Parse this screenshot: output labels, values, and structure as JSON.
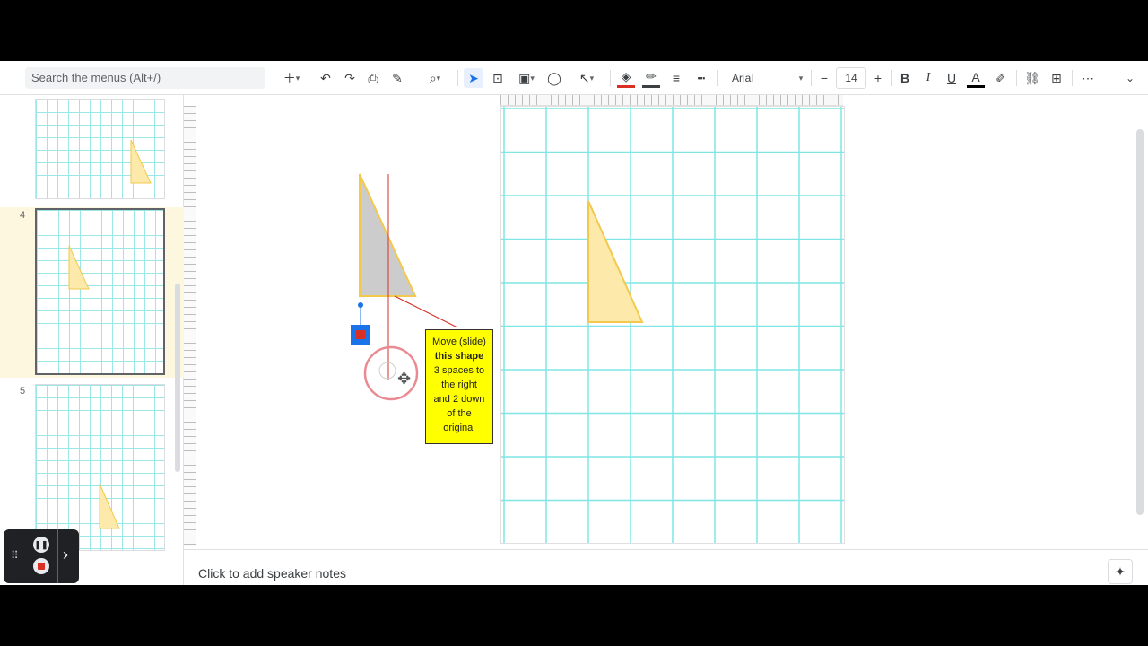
{
  "toolbar": {
    "search_placeholder": "Search the menus (Alt+/)",
    "font_name": "Arial",
    "font_size": "14",
    "icons": [
      "new-slide-icon",
      "undo-icon",
      "redo-icon",
      "print-icon",
      "paint-format-icon",
      "zoom-icon",
      "select-icon",
      "text-box-icon",
      "image-icon",
      "shape-icon",
      "line-icon",
      "fill-color-icon",
      "border-color-icon",
      "border-weight-icon",
      "border-dash-icon",
      "decrease-font-icon",
      "increase-font-icon",
      "bold-icon",
      "italic-icon",
      "underline-icon",
      "text-color-icon",
      "highlight-icon",
      "link-icon",
      "comment-icon",
      "more-icon",
      "collapse-icon"
    ]
  },
  "filmstrip": {
    "slides": [
      {
        "number": "",
        "active": false
      },
      {
        "number": "4",
        "active": true
      },
      {
        "number": "5",
        "active": false
      }
    ]
  },
  "canvas": {
    "callout_line1": "Move (slide)",
    "callout_bold": "this shape",
    "callout_line3": "3 spaces to",
    "callout_line4": "the right",
    "callout_line5": "and 2 down",
    "callout_line6": "of the",
    "callout_line7": "original"
  },
  "notes": {
    "placeholder": "Click to add speaker notes"
  },
  "colors": {
    "grid": "#7fe5e5",
    "triangle_fill": "#fde9a9",
    "triangle_stroke": "#f2c94c",
    "callout_bg": "#ffff00",
    "red": "#d93025"
  }
}
